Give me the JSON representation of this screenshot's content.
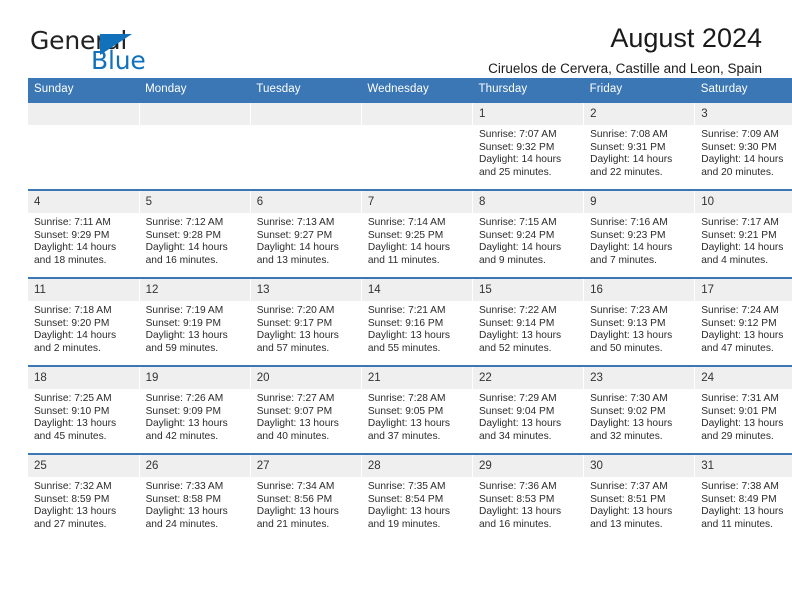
{
  "logo": {
    "word_one": "General",
    "word_two": "Blue",
    "triangle_icon": "triangle-icon",
    "color_dark": "#222222",
    "color_blue": "#1271bb"
  },
  "header": {
    "title": "August 2024",
    "subtitle": "Ciruelos de Cervera, Castille and Leon, Spain"
  },
  "theme": {
    "accent": "#3b77b4",
    "daynum_bg": "#efefef",
    "text": "#1a1a1a"
  },
  "calendar": {
    "weekday_headers": [
      "Sunday",
      "Monday",
      "Tuesday",
      "Wednesday",
      "Thursday",
      "Friday",
      "Saturday"
    ],
    "weeks": [
      [
        {
          "day": "",
          "lines": []
        },
        {
          "day": "",
          "lines": []
        },
        {
          "day": "",
          "lines": []
        },
        {
          "day": "",
          "lines": []
        },
        {
          "day": "1",
          "lines": [
            "Sunrise: 7:07 AM",
            "Sunset: 9:32 PM",
            "Daylight: 14 hours",
            "and 25 minutes."
          ]
        },
        {
          "day": "2",
          "lines": [
            "Sunrise: 7:08 AM",
            "Sunset: 9:31 PM",
            "Daylight: 14 hours",
            "and 22 minutes."
          ]
        },
        {
          "day": "3",
          "lines": [
            "Sunrise: 7:09 AM",
            "Sunset: 9:30 PM",
            "Daylight: 14 hours",
            "and 20 minutes."
          ]
        }
      ],
      [
        {
          "day": "4",
          "lines": [
            "Sunrise: 7:11 AM",
            "Sunset: 9:29 PM",
            "Daylight: 14 hours",
            "and 18 minutes."
          ]
        },
        {
          "day": "5",
          "lines": [
            "Sunrise: 7:12 AM",
            "Sunset: 9:28 PM",
            "Daylight: 14 hours",
            "and 16 minutes."
          ]
        },
        {
          "day": "6",
          "lines": [
            "Sunrise: 7:13 AM",
            "Sunset: 9:27 PM",
            "Daylight: 14 hours",
            "and 13 minutes."
          ]
        },
        {
          "day": "7",
          "lines": [
            "Sunrise: 7:14 AM",
            "Sunset: 9:25 PM",
            "Daylight: 14 hours",
            "and 11 minutes."
          ]
        },
        {
          "day": "8",
          "lines": [
            "Sunrise: 7:15 AM",
            "Sunset: 9:24 PM",
            "Daylight: 14 hours",
            "and 9 minutes."
          ]
        },
        {
          "day": "9",
          "lines": [
            "Sunrise: 7:16 AM",
            "Sunset: 9:23 PM",
            "Daylight: 14 hours",
            "and 7 minutes."
          ]
        },
        {
          "day": "10",
          "lines": [
            "Sunrise: 7:17 AM",
            "Sunset: 9:21 PM",
            "Daylight: 14 hours",
            "and 4 minutes."
          ]
        }
      ],
      [
        {
          "day": "11",
          "lines": [
            "Sunrise: 7:18 AM",
            "Sunset: 9:20 PM",
            "Daylight: 14 hours",
            "and 2 minutes."
          ]
        },
        {
          "day": "12",
          "lines": [
            "Sunrise: 7:19 AM",
            "Sunset: 9:19 PM",
            "Daylight: 13 hours",
            "and 59 minutes."
          ]
        },
        {
          "day": "13",
          "lines": [
            "Sunrise: 7:20 AM",
            "Sunset: 9:17 PM",
            "Daylight: 13 hours",
            "and 57 minutes."
          ]
        },
        {
          "day": "14",
          "lines": [
            "Sunrise: 7:21 AM",
            "Sunset: 9:16 PM",
            "Daylight: 13 hours",
            "and 55 minutes."
          ]
        },
        {
          "day": "15",
          "lines": [
            "Sunrise: 7:22 AM",
            "Sunset: 9:14 PM",
            "Daylight: 13 hours",
            "and 52 minutes."
          ]
        },
        {
          "day": "16",
          "lines": [
            "Sunrise: 7:23 AM",
            "Sunset: 9:13 PM",
            "Daylight: 13 hours",
            "and 50 minutes."
          ]
        },
        {
          "day": "17",
          "lines": [
            "Sunrise: 7:24 AM",
            "Sunset: 9:12 PM",
            "Daylight: 13 hours",
            "and 47 minutes."
          ]
        }
      ],
      [
        {
          "day": "18",
          "lines": [
            "Sunrise: 7:25 AM",
            "Sunset: 9:10 PM",
            "Daylight: 13 hours",
            "and 45 minutes."
          ]
        },
        {
          "day": "19",
          "lines": [
            "Sunrise: 7:26 AM",
            "Sunset: 9:09 PM",
            "Daylight: 13 hours",
            "and 42 minutes."
          ]
        },
        {
          "day": "20",
          "lines": [
            "Sunrise: 7:27 AM",
            "Sunset: 9:07 PM",
            "Daylight: 13 hours",
            "and 40 minutes."
          ]
        },
        {
          "day": "21",
          "lines": [
            "Sunrise: 7:28 AM",
            "Sunset: 9:05 PM",
            "Daylight: 13 hours",
            "and 37 minutes."
          ]
        },
        {
          "day": "22",
          "lines": [
            "Sunrise: 7:29 AM",
            "Sunset: 9:04 PM",
            "Daylight: 13 hours",
            "and 34 minutes."
          ]
        },
        {
          "day": "23",
          "lines": [
            "Sunrise: 7:30 AM",
            "Sunset: 9:02 PM",
            "Daylight: 13 hours",
            "and 32 minutes."
          ]
        },
        {
          "day": "24",
          "lines": [
            "Sunrise: 7:31 AM",
            "Sunset: 9:01 PM",
            "Daylight: 13 hours",
            "and 29 minutes."
          ]
        }
      ],
      [
        {
          "day": "25",
          "lines": [
            "Sunrise: 7:32 AM",
            "Sunset: 8:59 PM",
            "Daylight: 13 hours",
            "and 27 minutes."
          ]
        },
        {
          "day": "26",
          "lines": [
            "Sunrise: 7:33 AM",
            "Sunset: 8:58 PM",
            "Daylight: 13 hours",
            "and 24 minutes."
          ]
        },
        {
          "day": "27",
          "lines": [
            "Sunrise: 7:34 AM",
            "Sunset: 8:56 PM",
            "Daylight: 13 hours",
            "and 21 minutes."
          ]
        },
        {
          "day": "28",
          "lines": [
            "Sunrise: 7:35 AM",
            "Sunset: 8:54 PM",
            "Daylight: 13 hours",
            "and 19 minutes."
          ]
        },
        {
          "day": "29",
          "lines": [
            "Sunrise: 7:36 AM",
            "Sunset: 8:53 PM",
            "Daylight: 13 hours",
            "and 16 minutes."
          ]
        },
        {
          "day": "30",
          "lines": [
            "Sunrise: 7:37 AM",
            "Sunset: 8:51 PM",
            "Daylight: 13 hours",
            "and 13 minutes."
          ]
        },
        {
          "day": "31",
          "lines": [
            "Sunrise: 7:38 AM",
            "Sunset: 8:49 PM",
            "Daylight: 13 hours",
            "and 11 minutes."
          ]
        }
      ]
    ]
  }
}
